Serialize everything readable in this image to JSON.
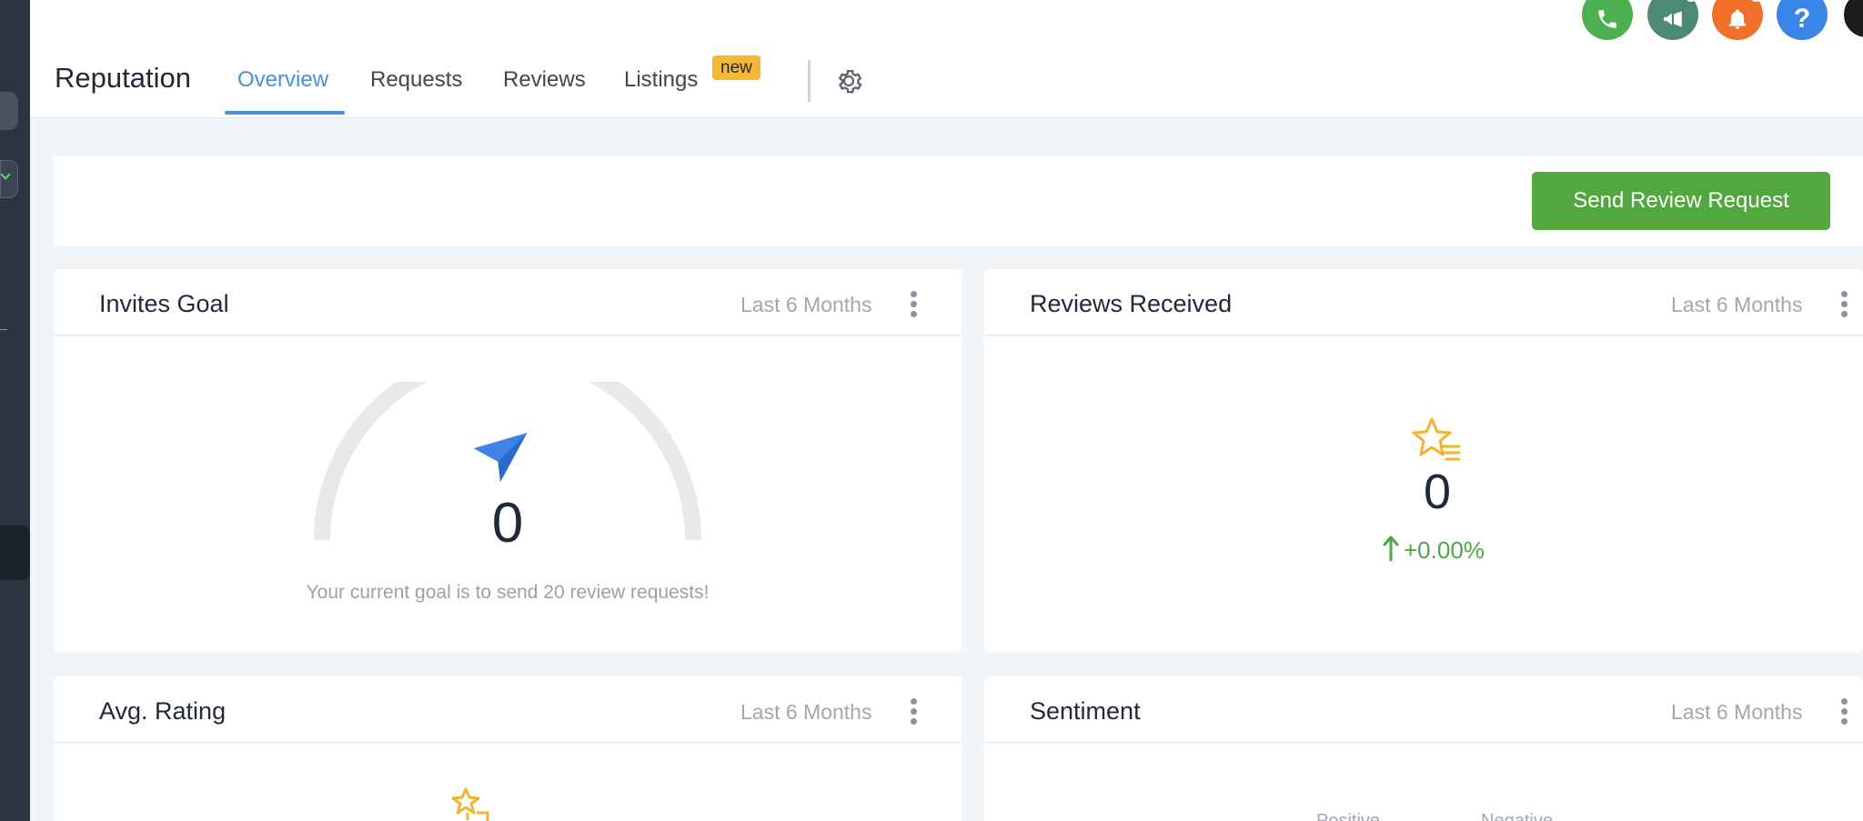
{
  "header": {
    "title": "Reputation",
    "tabs": [
      {
        "label": "Overview",
        "active": true
      },
      {
        "label": "Requests",
        "active": false
      },
      {
        "label": "Reviews",
        "active": false
      },
      {
        "label": "Listings",
        "active": false
      }
    ],
    "new_badge": "new",
    "settings_icon": "gear-icon",
    "top_icons": [
      {
        "name": "phone-icon",
        "color": "#4caf50"
      },
      {
        "name": "megaphone-icon",
        "color": "#4e8a73"
      },
      {
        "name": "bell-icon",
        "color": "#f0702a"
      },
      {
        "name": "help-icon",
        "color": "#3a86e8"
      }
    ]
  },
  "actions": {
    "send_review_request": "Send Review Request"
  },
  "cards": {
    "invites_goal": {
      "title": "Invites Goal",
      "range": "Last 6 Months",
      "value": "0",
      "goal_text": "Your current goal is to send 20 review requests!"
    },
    "reviews_received": {
      "title": "Reviews Received",
      "range": "Last 6 Months",
      "value": "0",
      "change": "+0.00%"
    },
    "avg_rating": {
      "title": "Avg. Rating",
      "range": "Last 6 Months"
    },
    "sentiment": {
      "title": "Sentiment",
      "range": "Last 6 Months",
      "legend": [
        "Positive",
        "Negative"
      ]
    }
  },
  "colors": {
    "accent": "#4a90d9",
    "primary_button": "#52a73f",
    "badge": "#f5b835",
    "positive": "#4ca64a",
    "star": "#f2b233"
  }
}
